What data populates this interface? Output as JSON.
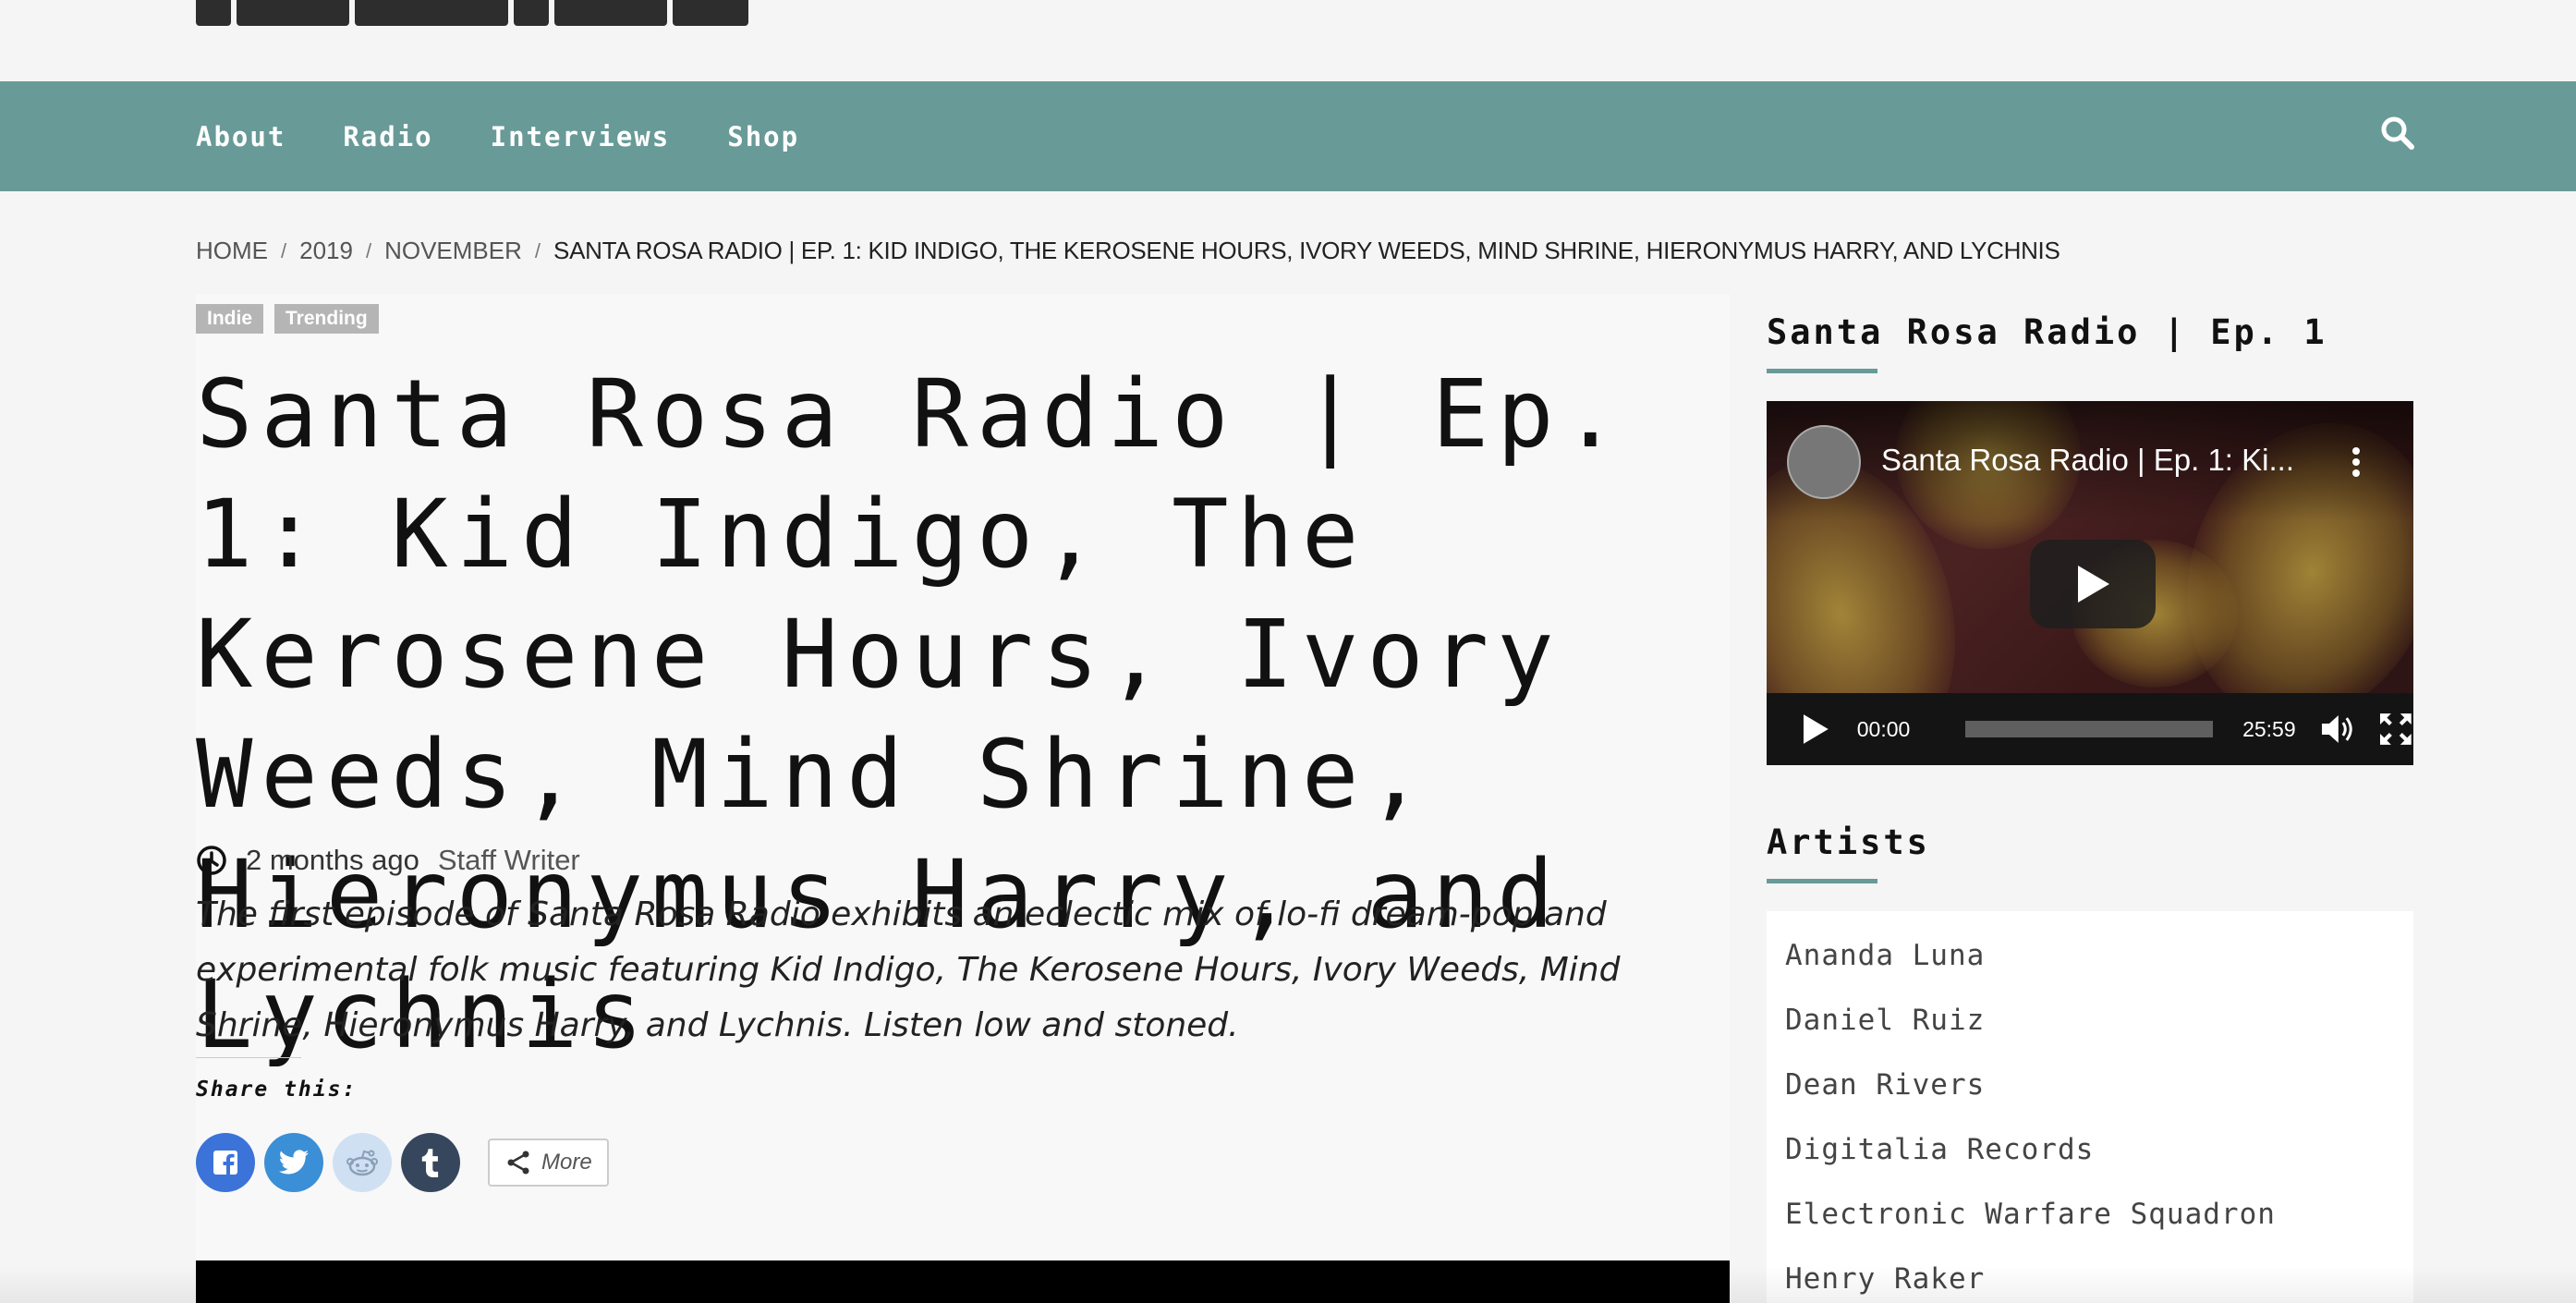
{
  "nav": {
    "items": [
      {
        "label": "About"
      },
      {
        "label": "Radio"
      },
      {
        "label": "Interviews"
      },
      {
        "label": "Shop"
      }
    ],
    "search_icon": "search-icon"
  },
  "breadcrumb": {
    "home": "HOME",
    "year": "2019",
    "month": "NOVEMBER",
    "current": "SANTA ROSA RADIO | EP. 1: KID INDIGO, THE KEROSENE HOURS, IVORY WEEDS, MIND SHRINE, HIERONYMUS HARRY, AND LYCHNIS"
  },
  "article": {
    "tags": [
      "Indie",
      "Trending"
    ],
    "title": "Santa Rosa Radio | Ep. 1: Kid Indigo, The Kerosene Hours, Ivory Weeds, Mind Shrine, Hieronymus Harry, and Lychnis",
    "date": "2 months ago",
    "author": "Staff Writer",
    "excerpt": "The first episode of Santa Rosa Radio exhibits an eclectic mix of lo-fi dream-pop and experimental folk music featuring Kid Indigo, The Kerosene Hours, Ivory Weeds, Mind Shrine, Hieronymus Harry, and Lychnis. Listen low and stoned.",
    "share_title": "Share this:",
    "share_more": "More"
  },
  "sidebar": {
    "player_widget": {
      "title": "Santa Rosa Radio | Ep. 1",
      "video_title": "Santa Rosa Radio | Ep. 1: Ki...",
      "current_time": "00:00",
      "duration": "25:59"
    },
    "artists_widget": {
      "title": "Artists",
      "items": [
        "Ananda Luna",
        "Daniel Ruiz",
        "Dean Rivers",
        "Digitalia Records",
        "Electronic Warfare Squadron",
        "Henry Raker"
      ]
    }
  },
  "colors": {
    "nav_bg": "#689a97",
    "accent": "#689a97",
    "tag_bg": "#b5b5b5",
    "facebook": "#3b73d9",
    "twitter": "#3b8fd6",
    "reddit": "#cfe0f2",
    "tumblr": "#36465d"
  }
}
